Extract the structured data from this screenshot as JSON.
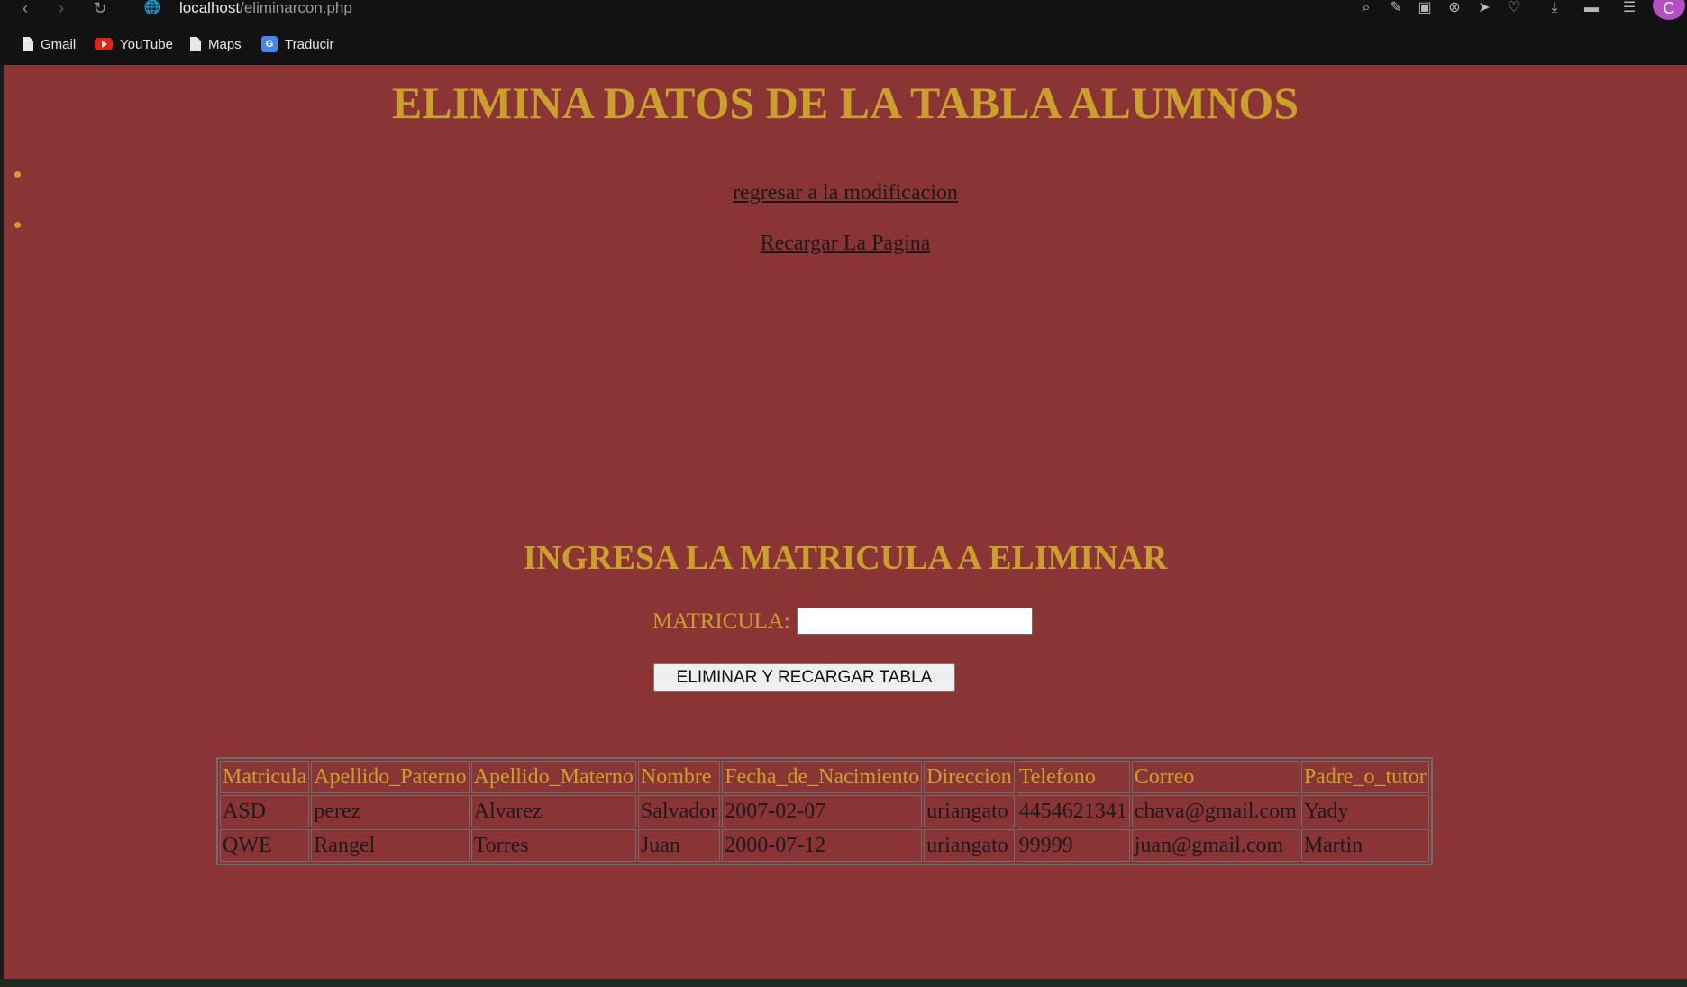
{
  "browser": {
    "url_host": "localhost",
    "url_path": "/eliminarcon.php",
    "avatar_letter": "C",
    "bookmarks": [
      {
        "label": "Gmail",
        "icon": "file-icon"
      },
      {
        "label": "YouTube",
        "icon": "youtube-icon"
      },
      {
        "label": "Maps",
        "icon": "file-icon"
      },
      {
        "label": "Traducir",
        "icon": "translate-icon"
      }
    ]
  },
  "page": {
    "title": "ELIMINA DATOS DE LA TABLA ALUMNOS",
    "links": [
      {
        "label": "regresar a la modificacion"
      },
      {
        "label": "Recargar La Pagina"
      }
    ],
    "subtitle": "INGRESA LA MATRICULA A ELIMINAR",
    "form": {
      "label": "MATRICULA:",
      "value": "",
      "button_label": "ELIMINAR Y RECARGAR TABLA"
    },
    "table": {
      "headers": [
        "Matricula",
        "Apellido_Paterno",
        "Apellido_Materno",
        "Nombre",
        "Fecha_de_Nacimiento",
        "Direccion",
        "Telefono",
        "Correo",
        "Padre_o_tutor"
      ],
      "rows": [
        [
          "ASD",
          "perez",
          "Alvarez",
          "Salvador",
          "2007-02-07",
          "uriangato",
          "4454621341",
          "chava@gmail.com",
          "Yady"
        ],
        [
          "QWE",
          "Rangel",
          "Torres",
          "Juan",
          "2000-07-12",
          "uriangato",
          "99999",
          "juan@gmail.com",
          "Martin"
        ]
      ]
    }
  },
  "colors": {
    "page_background": "#8b3436",
    "accent_gold": "#c8a02a",
    "text_dark": "#1b1b1b"
  }
}
